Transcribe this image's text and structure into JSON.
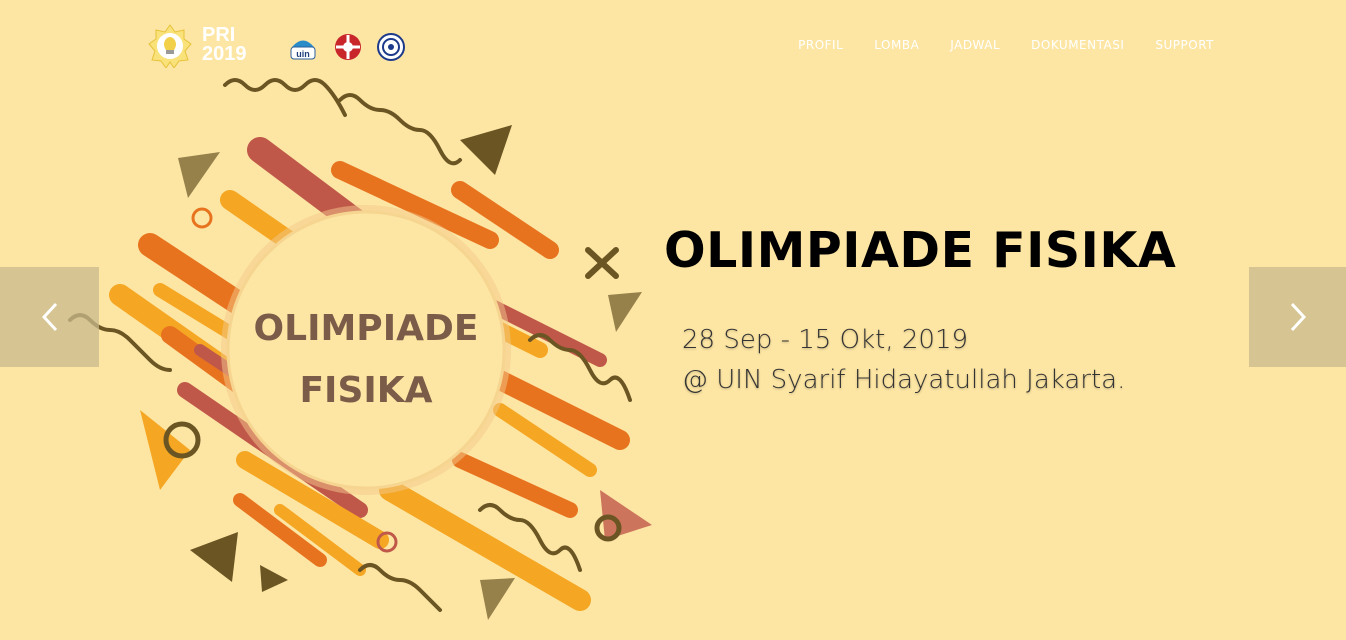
{
  "brand": {
    "line1": "PRI",
    "line2": "2019",
    "logo_icon": "lightbulb-badge-icon"
  },
  "partner_logos": [
    {
      "name": "uin-logo-icon",
      "text": "uin"
    },
    {
      "name": "faculty-emblem-icon"
    },
    {
      "name": "society-seal-icon"
    }
  ],
  "nav": {
    "items": [
      "PROFIL",
      "LOMBA",
      "JADWAL",
      "DOKUMENTASI",
      "SUPPORT"
    ]
  },
  "hero": {
    "badge_line1": "OLIMPIADE",
    "badge_line2": "FISIKA",
    "title": "OLIMPIADE FISIKA",
    "date": "28 Sep - 15 Okt, 2019",
    "venue": "@ UIN Syarif Hidayatullah Jakarta."
  },
  "carousel": {
    "prev_icon": "chevron-left-icon",
    "next_icon": "chevron-right-icon"
  },
  "colors": {
    "background": "#fde6a4",
    "orange": "#e8731f",
    "amber": "#f5a623",
    "brick": "#c0584a",
    "olive": "#6b5523",
    "badge_text": "#7a5c48"
  }
}
